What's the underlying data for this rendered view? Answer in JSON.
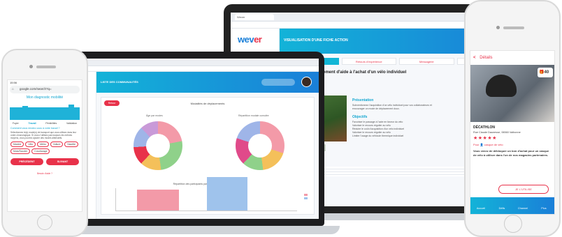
{
  "back_laptop": {
    "tab_title": "Wever",
    "logo_main": "wev",
    "logo_accent": "er",
    "header_title": "VISUALISATION D'UNE FICHE ACTION",
    "tabs": [
      "Fiche action",
      "Retours d'expérience",
      "Messagerie",
      "Questionnaire"
    ],
    "fiche_title": "ation : Subventionnement d'aide à l'achat d'un vélo individuel",
    "section_presentation": "Présentation",
    "presentation_text": "Subventionnez l'acquisition d'un vélo individuel pour vos collaborateurs et encourager un mode de déplacement doux.",
    "section_objectifs": "Objectifs",
    "objectifs": [
      "Favoriser le passage à l'acte en faveur du vélo",
      "Valoriser le recours régulier au vélo",
      "Réduire le coût d'acquisition d'un vélo individuel",
      "Valoriser le recours régulier au vélo",
      "Limiter l'usage du véhicule thermique individuel"
    ],
    "section_modalites": "odalités"
  },
  "front_laptop": {
    "header_title": "LISTE DES COMMUNAUTÉS",
    "back_button": "Retour",
    "card_title": "Modalités de déplacements",
    "donut1_label": "Âge par modes",
    "donut2_label": "Répartition modale cumulée",
    "bar_title": "Répartition des participants parmi les premiers de leur transport",
    "legend": [
      "Vélo",
      "Bus"
    ]
  },
  "left_phone": {
    "time": "15:56",
    "url": "google.com/search?q=",
    "title": "Mon diagnostic mobilité",
    "steps": [
      "Foyer",
      "Travail",
      "Pénibilités",
      "Validation"
    ],
    "active_step": "Travail",
    "question": "Comment vous rendez-vous à votre travail ?",
    "help_text": "Sélectionnez le(s) mode(s) de transport que vous utilisez dans leur ordre chronologique. Si vous n'utilisez pas toujours les mêmes moyens, vous pourrez ajouter des modes alternatifs.",
    "chips": [
      "Marche",
      "Vélo",
      "Métro",
      "Voiture",
      "Navette",
      "Moto/Scooter",
      "Covoiturage"
    ],
    "prev_button": "PRÉCÉDENT",
    "next_button": "SUIVANT",
    "help_link": "Besoin d'aide ?"
  },
  "right_phone": {
    "header": "Détails",
    "badge_count": "40",
    "store_name": "DÉCATHLON",
    "address": "Rue Claude Daunesse, 06560 Valbonne",
    "stars": "★★★★★",
    "for_label": "Pour",
    "for_value": "casque de vélo",
    "description": "Vous venez de débloquer un bon d'achat pour un casque de vélo à utiliser dans l'un de nos magasins partenaires.",
    "use_button": "JE L'UTILISE",
    "tabs": [
      "Accueil",
      "Défis",
      "Channel",
      "Plus"
    ]
  },
  "colors": {
    "accent_red": "#e8324a",
    "accent_cyan": "#13b3d8",
    "accent_blue": "#1a7fd8"
  }
}
